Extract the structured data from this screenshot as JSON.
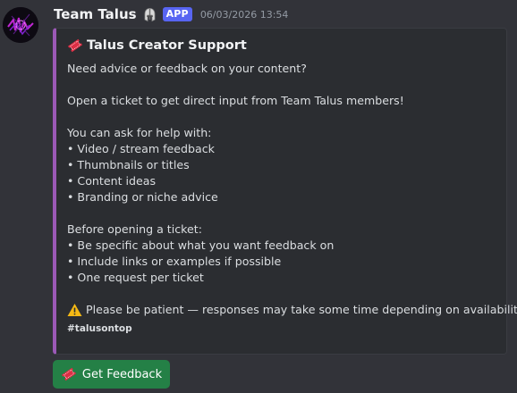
{
  "message": {
    "username": "Team Talus",
    "role_icon": "helmet-icon",
    "app_badge": "APP",
    "timestamp": "06/03/2026 13:54"
  },
  "embed": {
    "accent_color": "#9b59b6",
    "title_icon": "ticket-icon",
    "title": "Talus Creator Support",
    "intro": "Need advice or feedback on your content?",
    "open_ticket": "Open a ticket to get direct input from Team Talus members!",
    "help_header": "You can ask for help with:",
    "help_items": [
      "• Video / stream feedback",
      "• Thumbnails or titles",
      "• Content ideas",
      "• Branding or niche advice"
    ],
    "before_header": "Before opening a ticket:",
    "before_items": [
      "• Be specific about what you want feedback on",
      "• Include links or examples if possible",
      "• One request per ticket"
    ],
    "warning_icon": "warning-icon",
    "warning": "Please be patient — responses may take some time depending on availability.",
    "footer": "#talusontop"
  },
  "button": {
    "icon": "ticket-icon",
    "label": "Get Feedback",
    "color": "#248046"
  }
}
